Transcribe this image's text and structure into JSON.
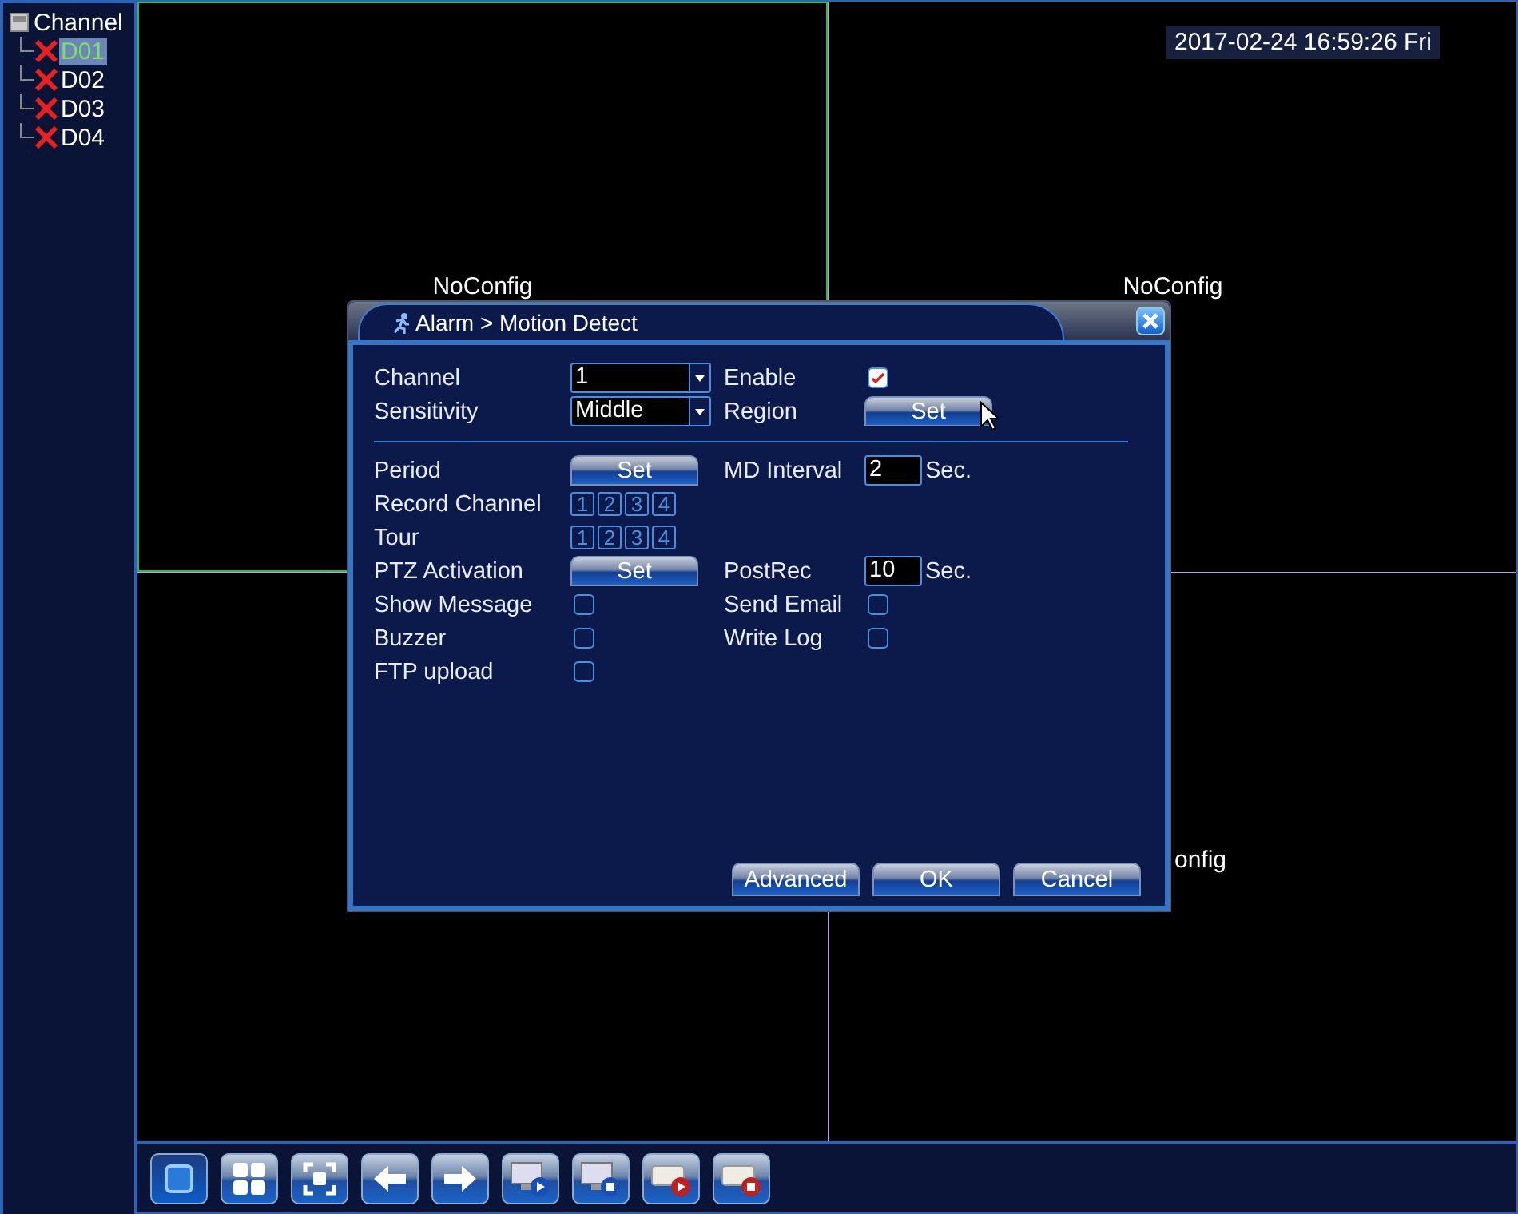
{
  "sidebar": {
    "root": {
      "label": "Channel",
      "children": [
        {
          "label": "D01",
          "selected": true,
          "connected": false
        },
        {
          "label": "D02",
          "selected": false,
          "connected": false
        },
        {
          "label": "D03",
          "selected": false,
          "connected": false
        },
        {
          "label": "D04",
          "selected": false,
          "connected": false
        }
      ]
    }
  },
  "timestamp": "2017-02-24 16:59:26 Fri",
  "views": [
    {
      "label": "NoConfig",
      "selected": true
    },
    {
      "label": "NoConfig",
      "selected": false
    },
    {
      "selected": false
    },
    {
      "label": "onfig",
      "selected": false
    }
  ],
  "dialog": {
    "title": "Alarm > Motion Detect",
    "sections": [
      [
        {
          "label": "Channel",
          "field": {
            "kind": "select",
            "value": "1"
          },
          "right": {
            "label": "Enable",
            "field": {
              "kind": "checkbox",
              "checked": true
            }
          }
        },
        {
          "label": "Sensitivity",
          "field": {
            "kind": "select",
            "value": "Middle"
          },
          "right": {
            "label": "Region",
            "field": {
              "kind": "button",
              "text": "Set"
            }
          }
        }
      ],
      [
        {
          "label": "Period",
          "field": {
            "kind": "button",
            "text": "Set"
          },
          "right": {
            "label": "MD Interval",
            "field": {
              "kind": "number",
              "value": "2",
              "unit": "Sec."
            }
          }
        },
        {
          "label": "Record Channel",
          "field": {
            "kind": "toggles",
            "items": [
              "1",
              "2",
              "3",
              "4"
            ]
          }
        },
        {
          "label": "Tour",
          "field": {
            "kind": "toggles",
            "items": [
              "1",
              "2",
              "3",
              "4"
            ]
          }
        },
        {
          "label": "PTZ Activation",
          "field": {
            "kind": "button",
            "text": "Set"
          },
          "right": {
            "label": "PostRec",
            "field": {
              "kind": "number",
              "value": "10",
              "unit": "Sec."
            }
          }
        },
        {
          "label": "Show Message",
          "field": {
            "kind": "checkbox",
            "checked": false
          },
          "right": {
            "label": "Send Email",
            "field": {
              "kind": "checkbox",
              "checked": false
            }
          }
        },
        {
          "label": "Buzzer",
          "field": {
            "kind": "checkbox",
            "checked": false
          },
          "right": {
            "label": "Write Log",
            "field": {
              "kind": "checkbox",
              "checked": false
            }
          }
        },
        {
          "label": "FTP upload",
          "field": {
            "kind": "checkbox",
            "checked": false
          }
        }
      ]
    ],
    "buttons": [
      "Advanced",
      "OK",
      "Cancel"
    ]
  },
  "toolbar": [
    {
      "kind": "single",
      "selected": true
    },
    {
      "kind": "quad",
      "selected": false
    },
    {
      "kind": "fullscreen",
      "selected": false
    },
    {
      "kind": "prev",
      "selected": false
    },
    {
      "kind": "next",
      "selected": false
    },
    {
      "kind": "monitor-play",
      "selected": false
    },
    {
      "kind": "monitor-stop",
      "selected": false
    },
    {
      "kind": "record-play",
      "selected": false
    },
    {
      "kind": "record-stop",
      "selected": false
    }
  ]
}
